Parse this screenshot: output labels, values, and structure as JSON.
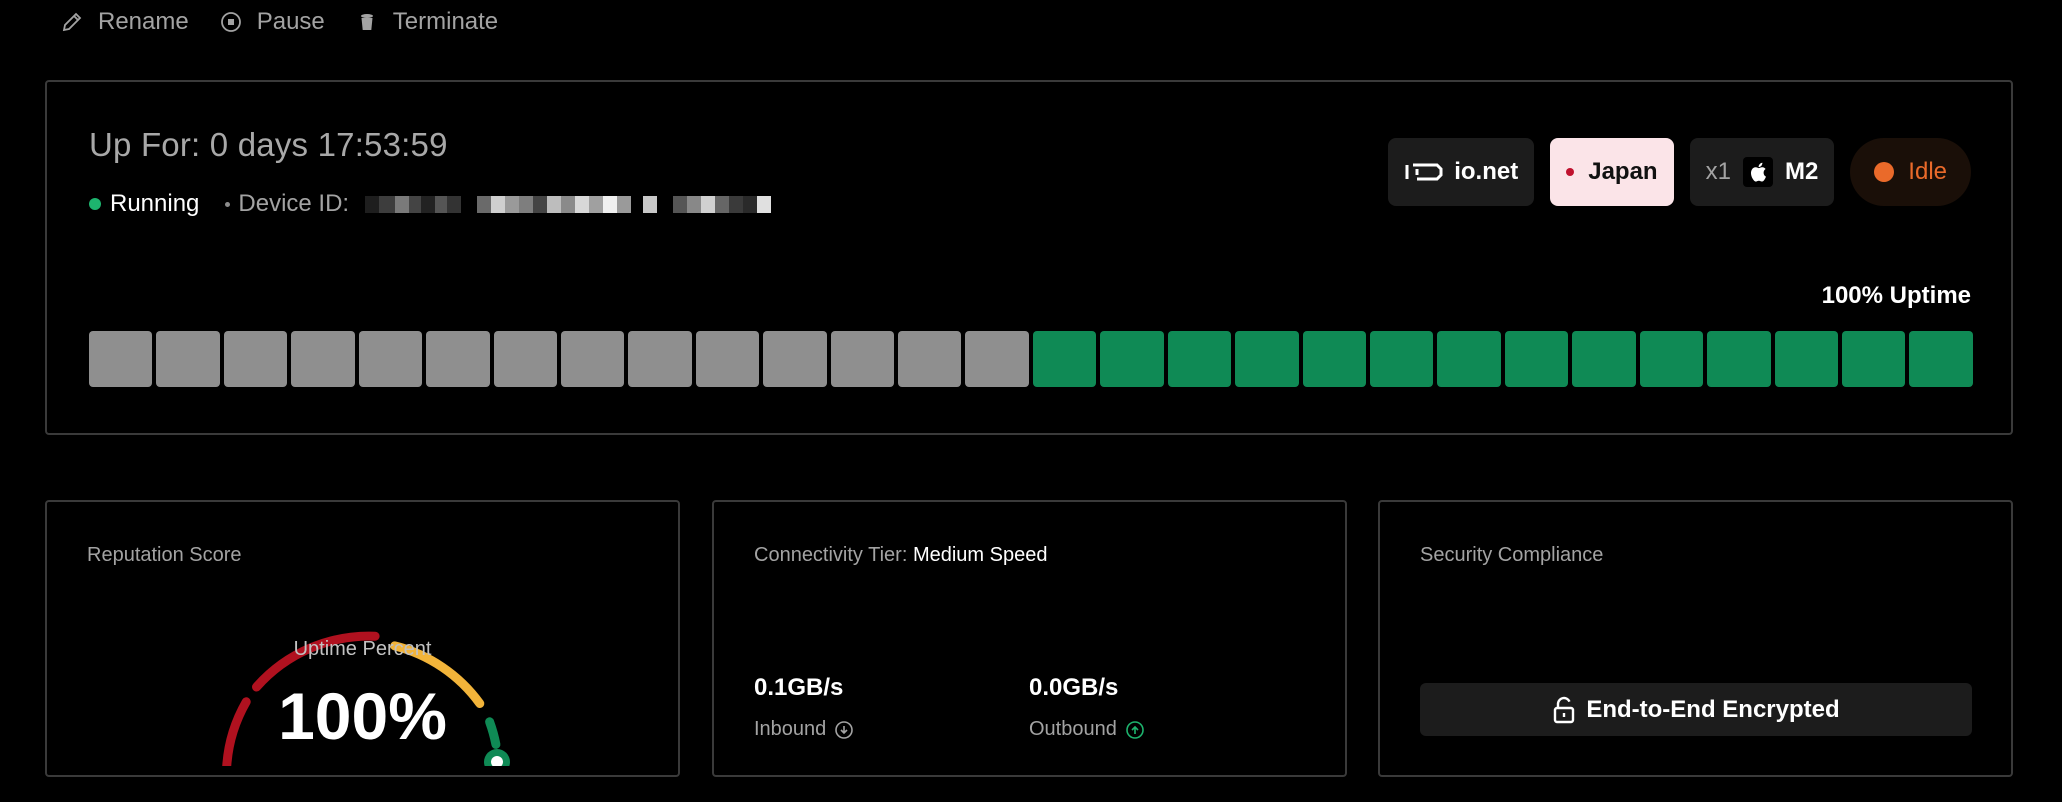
{
  "toolbar": {
    "rename": {
      "label": "Rename",
      "icon": "pencil-icon"
    },
    "pause": {
      "label": "Pause",
      "icon": "pause-circle-icon"
    },
    "terminate": {
      "label": "Terminate",
      "icon": "trash-icon"
    }
  },
  "device": {
    "uptime_text": "Up For: 0 days 17:53:59",
    "status": "Running",
    "status_color": "#1db46e",
    "device_id_label": "Device ID:",
    "device_id_redacted": true
  },
  "badges": {
    "network": "io.net",
    "location": "Japan",
    "location_dot_color": "#c0112e",
    "chip_count": "x1",
    "chip_icon": "apple-icon",
    "chip": "M2",
    "state": "Idle",
    "state_color": "#ea6a2a"
  },
  "uptime": {
    "label": "100% Uptime",
    "bars": [
      "off",
      "off",
      "off",
      "off",
      "off",
      "off",
      "off",
      "off",
      "off",
      "off",
      "off",
      "off",
      "off",
      "off",
      "on",
      "on",
      "on",
      "on",
      "on",
      "on",
      "on",
      "on",
      "on",
      "on",
      "on",
      "on",
      "on",
      "on"
    ],
    "colors": {
      "off": "#8f8f8f",
      "on": "#0f8a55"
    }
  },
  "reputation": {
    "title": "Reputation Score",
    "gauge_label": "Uptime Percent",
    "gauge_value": "100%",
    "gauge_fraction": 1.0,
    "segment_colors": [
      "#b0111f",
      "#b0111f",
      "#f2b43a",
      "#0f8a55"
    ]
  },
  "connectivity": {
    "title": "Connectivity Tier:",
    "tier": "Medium Speed",
    "inbound_value": "0.1GB/s",
    "inbound_label": "Inbound",
    "outbound_value": "0.0GB/s",
    "outbound_label": "Outbound"
  },
  "security": {
    "title": "Security Compliance",
    "button_label": "End-to-End Encrypted"
  }
}
